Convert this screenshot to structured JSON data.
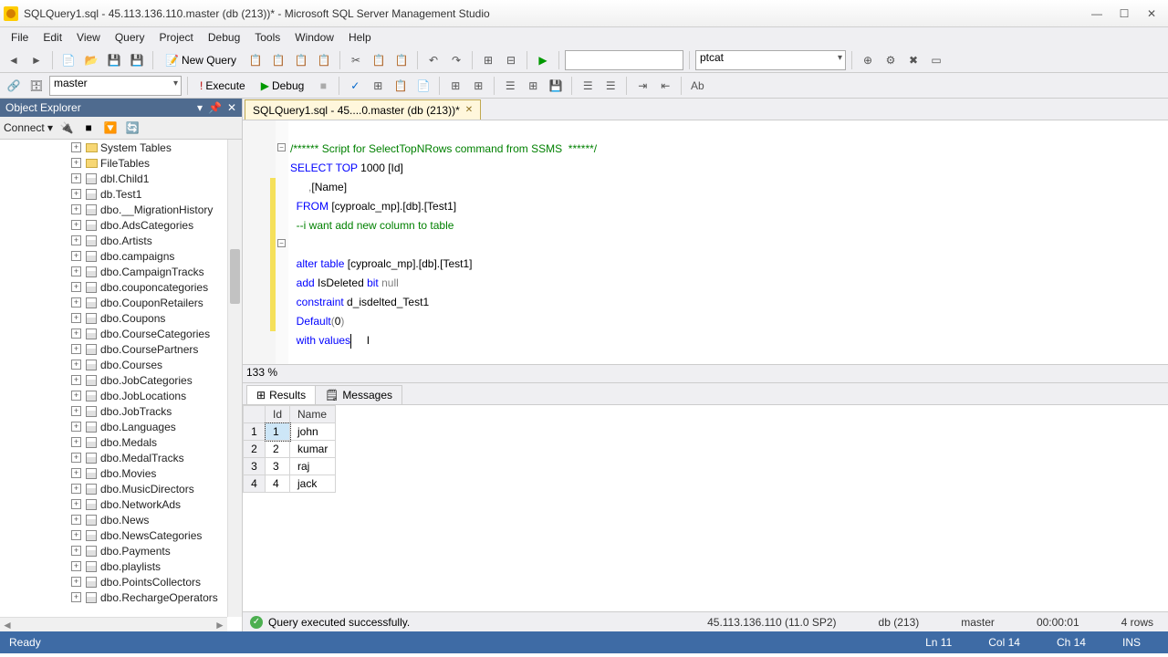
{
  "titlebar": {
    "title": "SQLQuery1.sql - 45.113.136.110.master (db (213))* - Microsoft SQL Server Management Studio"
  },
  "menu": [
    "File",
    "Edit",
    "View",
    "Query",
    "Project",
    "Debug",
    "Tools",
    "Window",
    "Help"
  ],
  "toolbar1": {
    "new_query": "New Query",
    "combo_right": "ptcat"
  },
  "toolbar2": {
    "database": "master",
    "execute": "Execute",
    "debug": "Debug"
  },
  "object_explorer": {
    "title": "Object Explorer",
    "connect": "Connect",
    "nodes": [
      {
        "type": "folder",
        "label": "System Tables"
      },
      {
        "type": "folder",
        "label": "FileTables"
      },
      {
        "type": "table",
        "label": "dbl.Child1"
      },
      {
        "type": "table",
        "label": "db.Test1"
      },
      {
        "type": "table",
        "label": "dbo.__MigrationHistory"
      },
      {
        "type": "table",
        "label": "dbo.AdsCategories"
      },
      {
        "type": "table",
        "label": "dbo.Artists"
      },
      {
        "type": "table",
        "label": "dbo.campaigns"
      },
      {
        "type": "table",
        "label": "dbo.CampaignTracks"
      },
      {
        "type": "table",
        "label": "dbo.couponcategories"
      },
      {
        "type": "table",
        "label": "dbo.CouponRetailers"
      },
      {
        "type": "table",
        "label": "dbo.Coupons"
      },
      {
        "type": "table",
        "label": "dbo.CourseCategories"
      },
      {
        "type": "table",
        "label": "dbo.CoursePartners"
      },
      {
        "type": "table",
        "label": "dbo.Courses"
      },
      {
        "type": "table",
        "label": "dbo.JobCategories"
      },
      {
        "type": "table",
        "label": "dbo.JobLocations"
      },
      {
        "type": "table",
        "label": "dbo.JobTracks"
      },
      {
        "type": "table",
        "label": "dbo.Languages"
      },
      {
        "type": "table",
        "label": "dbo.Medals"
      },
      {
        "type": "table",
        "label": "dbo.MedalTracks"
      },
      {
        "type": "table",
        "label": "dbo.Movies"
      },
      {
        "type": "table",
        "label": "dbo.MusicDirectors"
      },
      {
        "type": "table",
        "label": "dbo.NetworkAds"
      },
      {
        "type": "table",
        "label": "dbo.News"
      },
      {
        "type": "table",
        "label": "dbo.NewsCategories"
      },
      {
        "type": "table",
        "label": "dbo.Payments"
      },
      {
        "type": "table",
        "label": "dbo.playlists"
      },
      {
        "type": "table",
        "label": "dbo.PointsCollectors"
      },
      {
        "type": "table",
        "label": "dbo.RechargeOperators"
      }
    ]
  },
  "doc_tab": {
    "label": "SQLQuery1.sql - 45....0.master (db (213))*"
  },
  "code": {
    "line1_comment": "/****** Script for SelectTopNRows command from SSMS  ******/",
    "line2_a": "SELECT",
    "line2_b": "TOP",
    "line2_c": "1000",
    "line2_d": "[Id]",
    "line3": ",[Name]",
    "line4_a": "FROM",
    "line4_b": "[cyproalc_mp].[db].[Test1]",
    "line5": "--i want add new column to table",
    "line7_a": "alter",
    "line7_b": "table",
    "line7_c": "[cyproalc_mp].[db].[Test1]",
    "line8_a": "add",
    "line8_b": "IsDeleted",
    "line8_c": "bit",
    "line8_d": "null",
    "line9_a": "constraint",
    "line9_b": "d_isdelted_Test1",
    "line10_a": "Default",
    "line10_b": "(",
    "line10_c": "0",
    "line10_d": ")",
    "line11_a": "with",
    "line11_b": "values"
  },
  "zoom": "133 %",
  "result_tabs": {
    "results": "Results",
    "messages": "Messages"
  },
  "grid": {
    "headers": [
      "Id",
      "Name"
    ],
    "rows": [
      {
        "n": "1",
        "id": "1",
        "name": "john"
      },
      {
        "n": "2",
        "id": "2",
        "name": "kumar"
      },
      {
        "n": "3",
        "id": "3",
        "name": "raj"
      },
      {
        "n": "4",
        "id": "4",
        "name": "jack"
      }
    ]
  },
  "query_status": {
    "msg": "Query executed successfully.",
    "server": "45.113.136.110 (11.0 SP2)",
    "user": "db (213)",
    "db": "master",
    "time": "00:00:01",
    "rows": "4 rows"
  },
  "app_status": {
    "ready": "Ready",
    "ln": "Ln 11",
    "col": "Col 14",
    "ch": "Ch 14",
    "ins": "INS"
  }
}
